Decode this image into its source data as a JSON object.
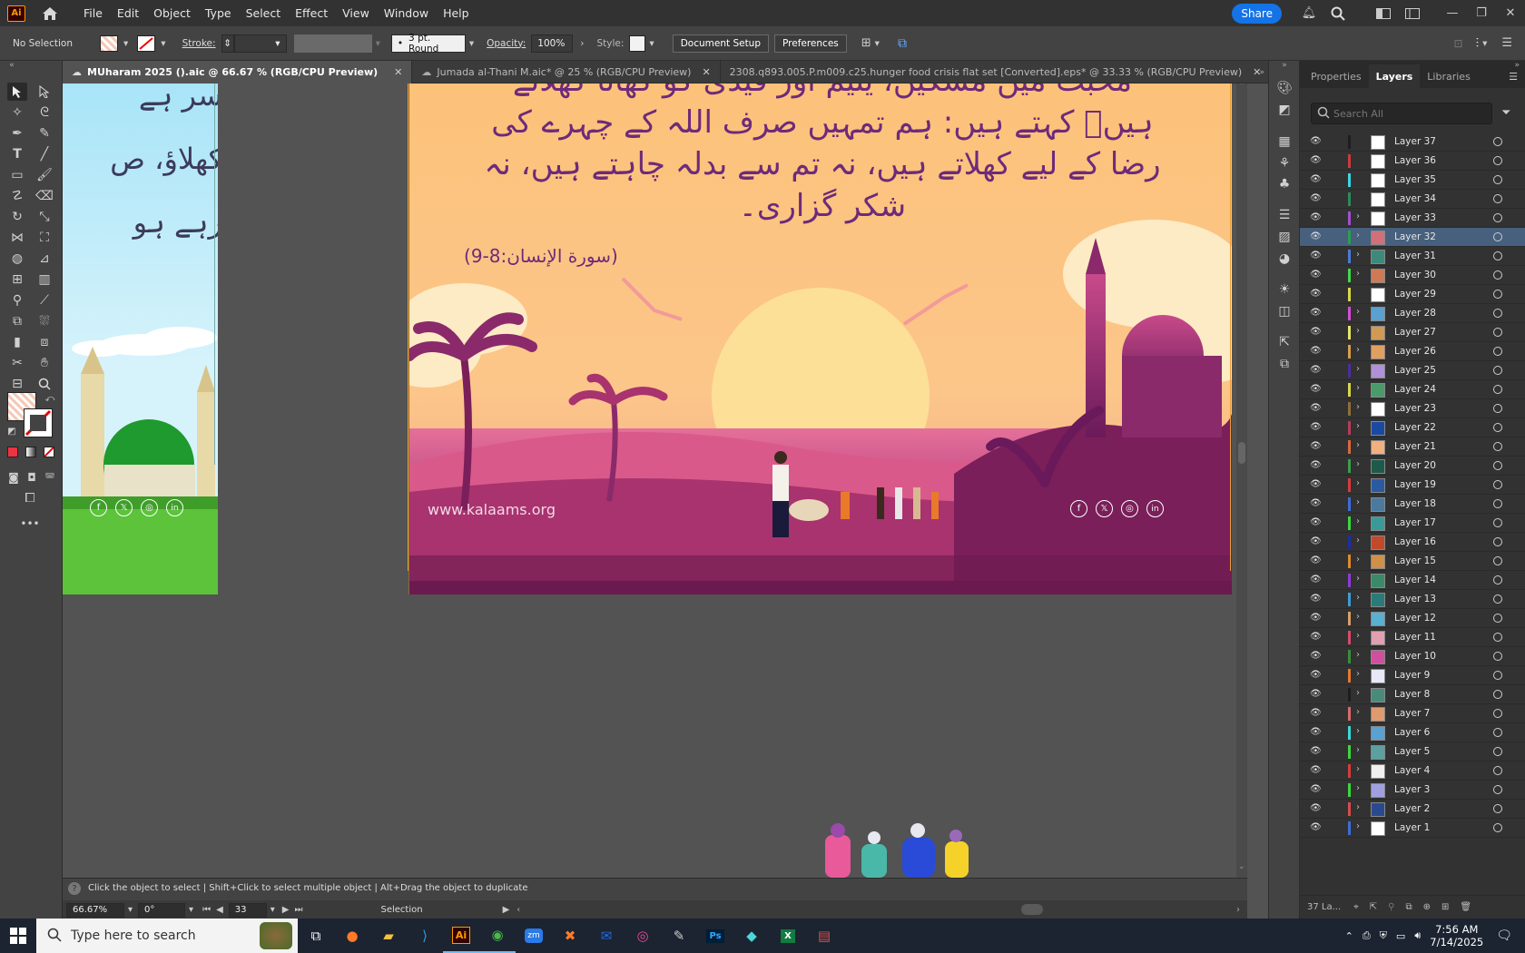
{
  "app": {
    "logo": "Ai"
  },
  "menu": [
    "File",
    "Edit",
    "Object",
    "Type",
    "Select",
    "Effect",
    "View",
    "Window",
    "Help"
  ],
  "share_label": "Share",
  "control": {
    "selection": "No Selection",
    "stroke_label": "Stroke:",
    "brush_label": "3 pt. Round",
    "opacity_label": "Opacity:",
    "opacity_value": "100%",
    "style_label": "Style:",
    "doc_setup": "Document Setup",
    "preferences": "Preferences"
  },
  "tabs": [
    {
      "label": "MUharam 2025 ().aic @ 66.67 % (RGB/CPU Preview)",
      "active": true
    },
    {
      "label": "Jumada al-Thani M.aic* @ 25 % (RGB/CPU Preview)",
      "active": false
    },
    {
      "label": "2308.q893.005.P.m009.c25.hunger food crisis flat set [Converted].eps* @ 33.33 % (RGB/CPU Preview)",
      "active": false
    }
  ],
  "artwork": {
    "left_text": [
      "سر ہے",
      "کھلاؤ، ص",
      "رہے ہو"
    ],
    "main_text": [
      "محبت میں مسکین، یتیم اور قیدی کو کھانا کھلاتے",
      "ہیںؒ کہتے ہیں: ہم تمہیں صرف اللہ کے چہرے کی",
      "رضا کے لیے کھلاتے ہیں، نہ تم سے بدلہ چاہتے ہیں، نہ",
      "شکر گزاری۔"
    ],
    "reference": "(سورة الإنسان:8-9)",
    "website": "www.kalaams.org",
    "social": [
      "f",
      "𝕏",
      "◎",
      "in"
    ]
  },
  "panel": {
    "tabs": [
      "Properties",
      "Layers",
      "Libraries"
    ],
    "active_tab": "Layers",
    "search_placeholder": "Search All",
    "layers": [
      {
        "name": "Layer 37",
        "color": "#1e1e1e",
        "expand": false,
        "thumb": "#ffffff"
      },
      {
        "name": "Layer 36",
        "color": "#cc3b3b",
        "expand": false,
        "thumb": "#ffffff"
      },
      {
        "name": "Layer 35",
        "color": "#3bd6e6",
        "expand": false,
        "thumb": "#ffffff"
      },
      {
        "name": "Layer 34",
        "color": "#2e8b57",
        "expand": false,
        "thumb": "#ffffff"
      },
      {
        "name": "Layer 33",
        "color": "#a050d0",
        "expand": true,
        "thumb": "#ffffff"
      },
      {
        "name": "Layer 32",
        "color": "#2e9e4f",
        "expand": true,
        "thumb": "#d0707a",
        "selected": true
      },
      {
        "name": "Layer 31",
        "color": "#4b7bd8",
        "expand": true,
        "thumb": "#3d8a7a"
      },
      {
        "name": "Layer 30",
        "color": "#45d64a",
        "expand": true,
        "thumb": "#d07a55"
      },
      {
        "name": "Layer 29",
        "color": "#d8d84b",
        "expand": false,
        "thumb": "#ffffff"
      },
      {
        "name": "Layer 28",
        "color": "#d84bd8",
        "expand": true,
        "thumb": "#5aa0d0"
      },
      {
        "name": "Layer 27",
        "color": "#e6e66a",
        "expand": true,
        "thumb": "#d09a55"
      },
      {
        "name": "Layer 26",
        "color": "#d8a04b",
        "expand": true,
        "thumb": "#e0a060"
      },
      {
        "name": "Layer 25",
        "color": "#4b2e9e",
        "expand": true,
        "thumb": "#b090d8"
      },
      {
        "name": "Layer 24",
        "color": "#d8d84b",
        "expand": true,
        "thumb": "#4a9a6a"
      },
      {
        "name": "Layer 23",
        "color": "#8e6e3b",
        "expand": true,
        "thumb": "#ffffff"
      },
      {
        "name": "Layer 22",
        "color": "#b83b5a",
        "expand": true,
        "thumb": "#1a4aa0"
      },
      {
        "name": "Layer 21",
        "color": "#d86a3b",
        "expand": true,
        "thumb": "#f0b080"
      },
      {
        "name": "Layer 20",
        "color": "#3b9e4b",
        "expand": true,
        "thumb": "#1e5a4a"
      },
      {
        "name": "Layer 19",
        "color": "#d83b3b",
        "expand": true,
        "thumb": "#2a5aa0"
      },
      {
        "name": "Layer 18",
        "color": "#3b6ed8",
        "expand": true,
        "thumb": "#4a7aa0"
      },
      {
        "name": "Layer 17",
        "color": "#3bd83b",
        "expand": true,
        "thumb": "#3a9a9a"
      },
      {
        "name": "Layer 16",
        "color": "#1e2e9e",
        "expand": true,
        "thumb": "#c04a2a"
      },
      {
        "name": "Layer 15",
        "color": "#e08a2e",
        "expand": true,
        "thumb": "#d0904a"
      },
      {
        "name": "Layer 14",
        "color": "#8e3bd8",
        "expand": true,
        "thumb": "#3a8a6a"
      },
      {
        "name": "Layer 13",
        "color": "#3b9ed8",
        "expand": true,
        "thumb": "#2a7a7a"
      },
      {
        "name": "Layer 12",
        "color": "#d8a06a",
        "expand": true,
        "thumb": "#5ab0d0"
      },
      {
        "name": "Layer 11",
        "color": "#d84b6a",
        "expand": true,
        "thumb": "#e0a0b0"
      },
      {
        "name": "Layer 10",
        "color": "#3b8e3b",
        "expand": true,
        "thumb": "#d050a0"
      },
      {
        "name": "Layer 9",
        "color": "#e07a2e",
        "expand": true,
        "thumb": "#e8e8f8"
      },
      {
        "name": "Layer 8",
        "color": "#1e1e1e",
        "expand": true,
        "thumb": "#4a8a7a"
      },
      {
        "name": "Layer 7",
        "color": "#d86a6a",
        "expand": true,
        "thumb": "#e09a70"
      },
      {
        "name": "Layer 6",
        "color": "#3bd8d8",
        "expand": true,
        "thumb": "#5aa0d0"
      },
      {
        "name": "Layer 5",
        "color": "#3bd83b",
        "expand": true,
        "thumb": "#5aa0a0"
      },
      {
        "name": "Layer 4",
        "color": "#d83b3b",
        "expand": true,
        "thumb": "#f0f0f0"
      },
      {
        "name": "Layer 3",
        "color": "#3bd83b",
        "expand": true,
        "thumb": "#a0a0e0"
      },
      {
        "name": "Layer 2",
        "color": "#d84b4b",
        "expand": true,
        "thumb": "#2a4a90"
      },
      {
        "name": "Layer 1",
        "color": "#3b6ed8",
        "expand": true,
        "thumb": "#ffffff"
      }
    ],
    "footer_count": "37 La..."
  },
  "status": {
    "hint": "Click the object to select  |  Shift+Click to select multiple object  |  Alt+Drag the object to duplicate",
    "zoom": "66.67%",
    "rotation": "0°",
    "artboard": "33",
    "tool": "Selection"
  },
  "taskbar": {
    "search_placeholder": "Type here to search",
    "time": "7:56 AM",
    "date": "7/14/2025"
  }
}
